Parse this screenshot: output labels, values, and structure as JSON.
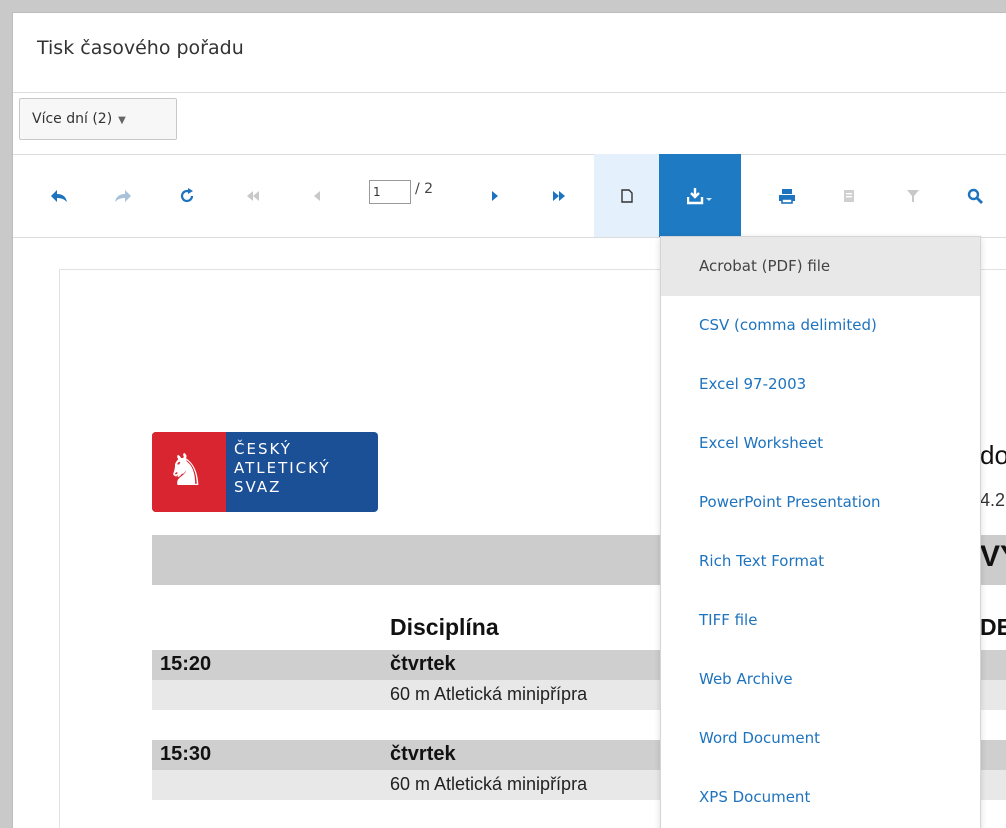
{
  "window": {
    "title": "Tisk časového pořadu"
  },
  "days_selector": {
    "label": "Více dní (2)",
    "arrow": "▼"
  },
  "toolbar": {
    "buttons": [
      {
        "name": "back",
        "glyph": "⬅"
      },
      {
        "name": "forward",
        "glyph": "➦"
      },
      {
        "name": "refresh",
        "glyph": "↻"
      },
      {
        "name": "first",
        "glyph": "⏮"
      },
      {
        "name": "prev",
        "glyph": "◀"
      },
      {
        "name": "next",
        "glyph": "▶"
      },
      {
        "name": "last",
        "glyph": "⏭"
      },
      {
        "name": "page-view",
        "glyph": "🗋"
      },
      {
        "name": "export",
        "glyph": "⤓"
      },
      {
        "name": "print",
        "glyph": "🖶"
      },
      {
        "name": "doc-map",
        "glyph": "▤"
      },
      {
        "name": "filter",
        "glyph": "⏷"
      },
      {
        "name": "search",
        "glyph": "🔍"
      }
    ],
    "page_current": "1",
    "page_total": "/ 2"
  },
  "export_menu": {
    "items": [
      "Acrobat (PDF) file",
      "CSV (comma delimited)",
      "Excel 97-2003",
      "Excel Worksheet",
      "PowerPoint Presentation",
      "Rich Text Format",
      "TIFF file",
      "Web Archive",
      "Word Document",
      "XPS Document"
    ],
    "selected_index": 0
  },
  "report": {
    "logo": {
      "line1": "ČESKÝ",
      "line2": "ATLETICKÝ",
      "line3": "SVAZ"
    },
    "right_fragments": {
      "title": "do",
      "date": "4.2",
      "heading": "VÝ",
      "sub": "DE"
    },
    "column_header": "Disciplína",
    "rows": [
      {
        "time": "15:20",
        "day": "čtvrtek",
        "discipline": "60 m Atletická minipřípra"
      },
      {
        "time": "15:30",
        "day": "čtvrtek",
        "discipline": "60 m Atletická minipřípra"
      }
    ]
  },
  "colors": {
    "accent": "#1e73be",
    "export_active": "#1f7ac4",
    "logo_blue": "#1b4f96",
    "logo_red": "#d8252f"
  }
}
